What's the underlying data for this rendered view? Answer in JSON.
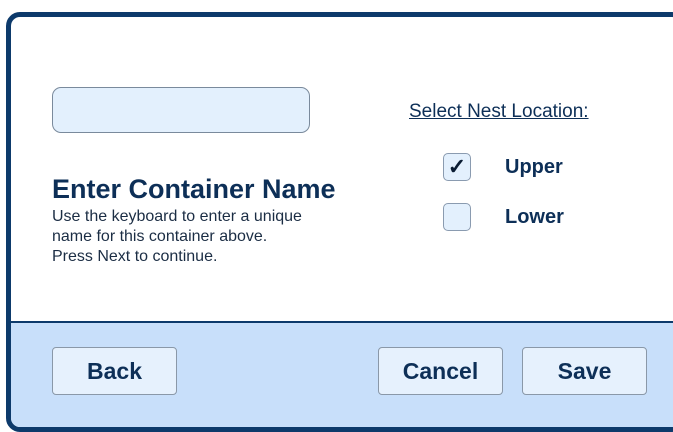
{
  "form": {
    "name_input_value": "",
    "title": "Enter Container Name",
    "instructions": [
      "Use the keyboard to enter a unique",
      "name for this container above.",
      "Press Next to continue."
    ]
  },
  "nest": {
    "heading": "Select Nest Location:",
    "options": [
      {
        "label": "Upper",
        "checked": true,
        "mark": "✓"
      },
      {
        "label": "Lower",
        "checked": false,
        "mark": ""
      }
    ]
  },
  "footer": {
    "back_label": "Back",
    "cancel_label": "Cancel",
    "save_label": "Save"
  },
  "colors": {
    "frame": "#0d3a6b",
    "footer_bg": "#c8dffa",
    "field_bg": "#e3f0fd",
    "text": "#0d2f57"
  }
}
